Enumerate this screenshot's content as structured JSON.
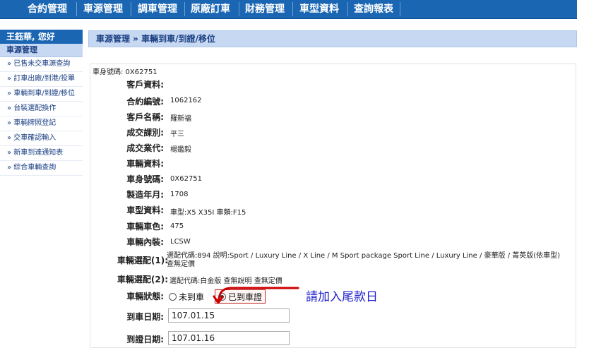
{
  "nav": [
    "合約管理",
    "車源管理",
    "調車管理",
    "原廠訂車",
    "財務管理",
    "車型資料",
    "查詢報表"
  ],
  "sidebar": {
    "user_greeting": "王鈺華, 您好",
    "section_title": "車源管理",
    "items": [
      "» 已售未交車源查詢",
      "» 訂車出廠/到港/投單",
      "» 車輛到車/到證/移位",
      "» 台裝選配換作",
      "» 車輛牌照登記",
      "» 交車確認輸入",
      "» 新車到達通知表",
      "» 綜合車輛查詢"
    ]
  },
  "breadcrumb": "車源管理 » 車輛到車/到證/移位",
  "chassis_header": "車身號碼: 0X62751",
  "labels": {
    "customer_info": "客戶資料:",
    "contract_no": "合約編號:",
    "customer_name": "客戶名稱:",
    "sales_dept": "成交課別:",
    "sales_rep": "成交業代:",
    "vehicle_info": "車輛資料:",
    "chassis_no": "車身號碼:",
    "mfg_date": "製造年月:",
    "model_info": "車型資料:",
    "color": "車輛車色:",
    "interior": "車輛內裝:",
    "option1": "車輛選配(1):",
    "option2": "車輛選配(2):",
    "status": "車輛狀態:",
    "arrival_date": "到車日期:",
    "cert_date": "到證日期:"
  },
  "values": {
    "contract_no": "1062162",
    "customer_name": "羅新福",
    "sales_dept": "平三",
    "sales_rep": "楊鑑毅",
    "chassis_no": "0X62751",
    "mfg_date": "1708",
    "model_info": "車型:X5 X35I  車類:F15",
    "color": "475",
    "interior": "LCSW",
    "option1": "選配代碼:894  說明:Sport / Luxury Line / X Line / M Sport package   Sport Line / Luxury Line / 豪華版 / 菁英版(依車型)  查無定價",
    "option2": "選配代碼:白金版   查無說明   查無定價"
  },
  "status_options": [
    "未到車",
    "已到車證"
  ],
  "status_selected": 1,
  "arrival_date": "107.01.15",
  "cert_date": "107.01.16",
  "annotation": "請加入尾款日",
  "colors": {
    "nav_bg": "#1a66b3",
    "panel_bg": "#c7d8f2",
    "annotation": "#2222cc",
    "arrow": "#cc0000"
  }
}
